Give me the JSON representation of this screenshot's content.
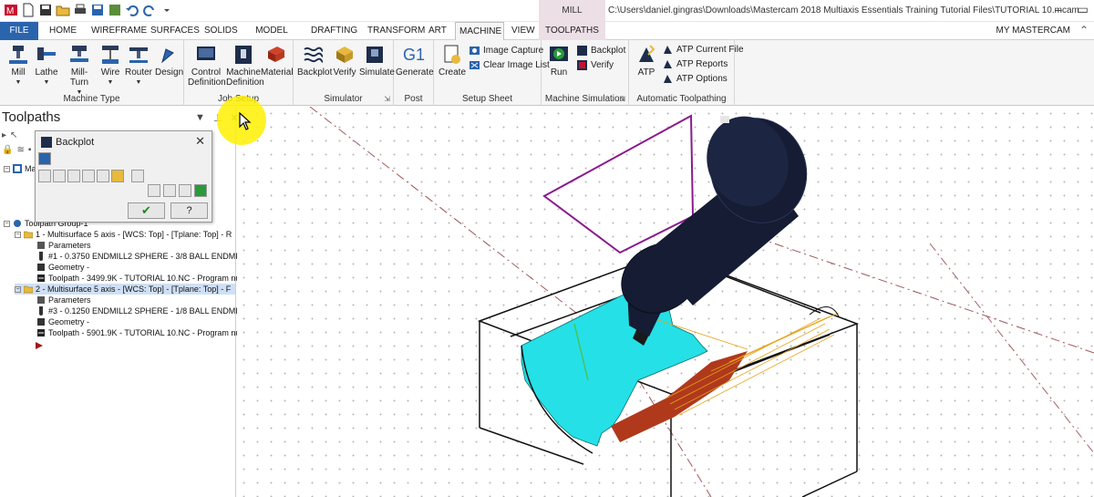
{
  "titlebar": {
    "context_tab": "MILL",
    "file_path": "C:\\Users\\daniel.gingras\\Downloads\\Mastercam 2018 Multiaxis Essentials Training Tutorial Files\\TUTORIAL 10.mcam..."
  },
  "tabs": {
    "file": "FILE",
    "home": "HOME",
    "wireframe": "WIREFRAME",
    "surfaces": "SURFACES",
    "solids": "SOLIDS",
    "model_prep": "MODEL PREP",
    "drafting": "DRAFTING",
    "transform": "TRANSFORM",
    "art": "ART",
    "machine": "MACHINE",
    "view": "VIEW",
    "toolpaths": "TOOLPATHS",
    "my_mastercam": "MY MASTERCAM"
  },
  "ribbon": {
    "machine_type": {
      "label": "Machine Type",
      "mill": "Mill",
      "lathe": "Lathe",
      "mill_turn": "Mill-Turn",
      "wire": "Wire",
      "router": "Router",
      "design": "Design"
    },
    "job_setup": {
      "label": "Job Setup",
      "control_definition_1": "Control",
      "control_definition_2": "Definition",
      "machine_definition_1": "Machine",
      "machine_definition_2": "Definition",
      "material": "Material"
    },
    "simulator": {
      "label": "Simulator",
      "backplot": "Backplot",
      "verify": "Verify",
      "simulate": "Simulate"
    },
    "post": {
      "label": "Post",
      "icon_text": "G1",
      "generate": "Generate"
    },
    "setup_sheet": {
      "label": "Setup Sheet",
      "create": "Create",
      "image_capture": "Image Capture",
      "clear_image_list": "Clear Image List"
    },
    "machine_simulation": {
      "label": "Machine Simulation",
      "run": "Run",
      "backplot": "Backplot",
      "verify": "Verify"
    },
    "automatic_toolpathing": {
      "label": "Automatic Toolpathing",
      "atp": "ATP",
      "atp_current_file": "ATP Current File",
      "atp_reports": "ATP Reports",
      "atp_options": "ATP Options"
    }
  },
  "toolpaths_panel": {
    "title": "Toolpaths",
    "tree": [
      "Ma",
      "Toolpath Group-1",
      "1 - Multisurface 5 axis - [WCS: Top] - [Tplane: Top] - R",
      "Parameters",
      "#1 - 0.3750 ENDMILL2 SPHERE - 3/8 BALL ENDMILL",
      "Geometry -",
      "Toolpath - 3499.9K - TUTORIAL 10.NC - Program nur",
      "2 - Multisurface 5 axis - [WCS: Top] - [Tplane: Top] - F",
      "Parameters",
      "#3 - 0.1250 ENDMILL2 SPHERE - 1/8 BALL ENDMILL",
      "Geometry -",
      "Toolpath - 5901.9K - TUTORIAL 10.NC - Program nur"
    ]
  },
  "backplot_dialog": {
    "title": "Backplot",
    "help": "?"
  },
  "colors": {
    "accent_blue": "#2a64ad",
    "mill_context": "#ecdfe5",
    "stock_cyan": "#25e0e6",
    "tool_body": "#151c33",
    "plane_purple": "#8a1a8e",
    "cursor_highlight": "#fff000"
  }
}
